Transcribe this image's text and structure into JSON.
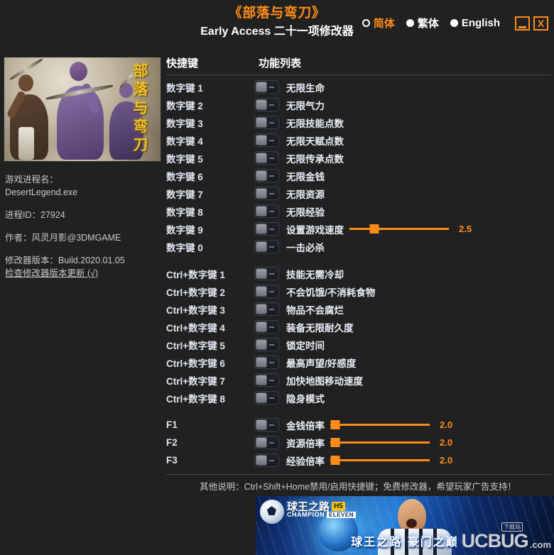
{
  "titlebar": {
    "title_main": "《部落与弯刀》",
    "title_sub": "Early Access 二十一项修改器",
    "languages": [
      {
        "label": "简体",
        "selected": true
      },
      {
        "label": "繁体",
        "selected": false
      },
      {
        "label": "English",
        "selected": false
      }
    ],
    "minimize_label": "",
    "close_label": "X"
  },
  "cover": {
    "calligraphy": [
      "部",
      "落",
      "与",
      "弯",
      "刀"
    ]
  },
  "info": {
    "process_name_label": "游戏进程名：",
    "process_name_value": "DesertLegend.exe",
    "process_id": "进程ID：27924",
    "author": "作者：风灵月影@3DMGAME",
    "trainer_version": "修改器版本：Build.2020.01.05",
    "update_link": "检查修改器版本更新 (√)"
  },
  "columns": {
    "hotkey": "快捷键",
    "function": "功能列表"
  },
  "rows": [
    {
      "key": "数字键 1",
      "label": "无限生命",
      "toggle": false
    },
    {
      "key": "数字键 2",
      "label": "无限气力",
      "toggle": false
    },
    {
      "key": "数字键 3",
      "label": "无限技能点数",
      "toggle": false
    },
    {
      "key": "数字键 4",
      "label": "无限天赋点数",
      "toggle": false
    },
    {
      "key": "数字键 5",
      "label": "无限传承点数",
      "toggle": false
    },
    {
      "key": "数字键 6",
      "label": "无限金钱",
      "toggle": false
    },
    {
      "key": "数字键 7",
      "label": "无限资源",
      "toggle": false
    },
    {
      "key": "数字键 8",
      "label": "无限经验",
      "toggle": false
    },
    {
      "key": "数字键 9",
      "label": "设置游戏速度",
      "toggle": false,
      "slider": {
        "value": "2.5",
        "percent": 25
      }
    },
    {
      "key": "数字键 0",
      "label": "一击必杀",
      "toggle": false
    },
    {
      "spacer": true
    },
    {
      "key": "Ctrl+数字键 1",
      "label": "技能无需冷却",
      "toggle": false
    },
    {
      "key": "Ctrl+数字键 2",
      "label": "不会饥饿/不消耗食物",
      "toggle": false
    },
    {
      "key": "Ctrl+数字键 3",
      "label": "物品不会腐烂",
      "toggle": false
    },
    {
      "key": "Ctrl+数字键 4",
      "label": "装备无限耐久度",
      "toggle": false
    },
    {
      "key": "Ctrl+数字键 5",
      "label": "锁定时间",
      "toggle": false
    },
    {
      "key": "Ctrl+数字键 6",
      "label": "最高声望/好感度",
      "toggle": false
    },
    {
      "key": "Ctrl+数字键 7",
      "label": "加快地图移动速度",
      "toggle": false
    },
    {
      "key": "Ctrl+数字键 8",
      "label": "隐身模式",
      "toggle": false
    },
    {
      "spacer": true
    },
    {
      "key": "F1",
      "label": "金钱倍率",
      "toggle": false,
      "slider": {
        "value": "2.0",
        "percent": 5
      }
    },
    {
      "key": "F2",
      "label": "资源倍率",
      "toggle": false,
      "slider": {
        "value": "2.0",
        "percent": 5
      }
    },
    {
      "key": "F3",
      "label": "经验倍率",
      "toggle": false,
      "slider": {
        "value": "2.0",
        "percent": 5
      }
    }
  ],
  "footer": {
    "note": "其他说明：Ctrl+Shift+Home禁用/启用快捷键；免费修改器，希望玩家广告支持！"
  },
  "banner": {
    "logo_cn": "球王之路",
    "logo_h5": "H5",
    "logo_en_main": "CHAMPION",
    "logo_en_sub": "ELEVEN",
    "tagline": "球王之路 豪门之巅",
    "watermark_main": "UCBUG",
    "watermark_domain": ".com",
    "watermark_tag": "下载站"
  },
  "colors": {
    "accent": "#ff8c1a",
    "background": "#212121",
    "text": "#e8eef6",
    "muted": "#c8c8c8",
    "divider": "#4a4a4a"
  }
}
